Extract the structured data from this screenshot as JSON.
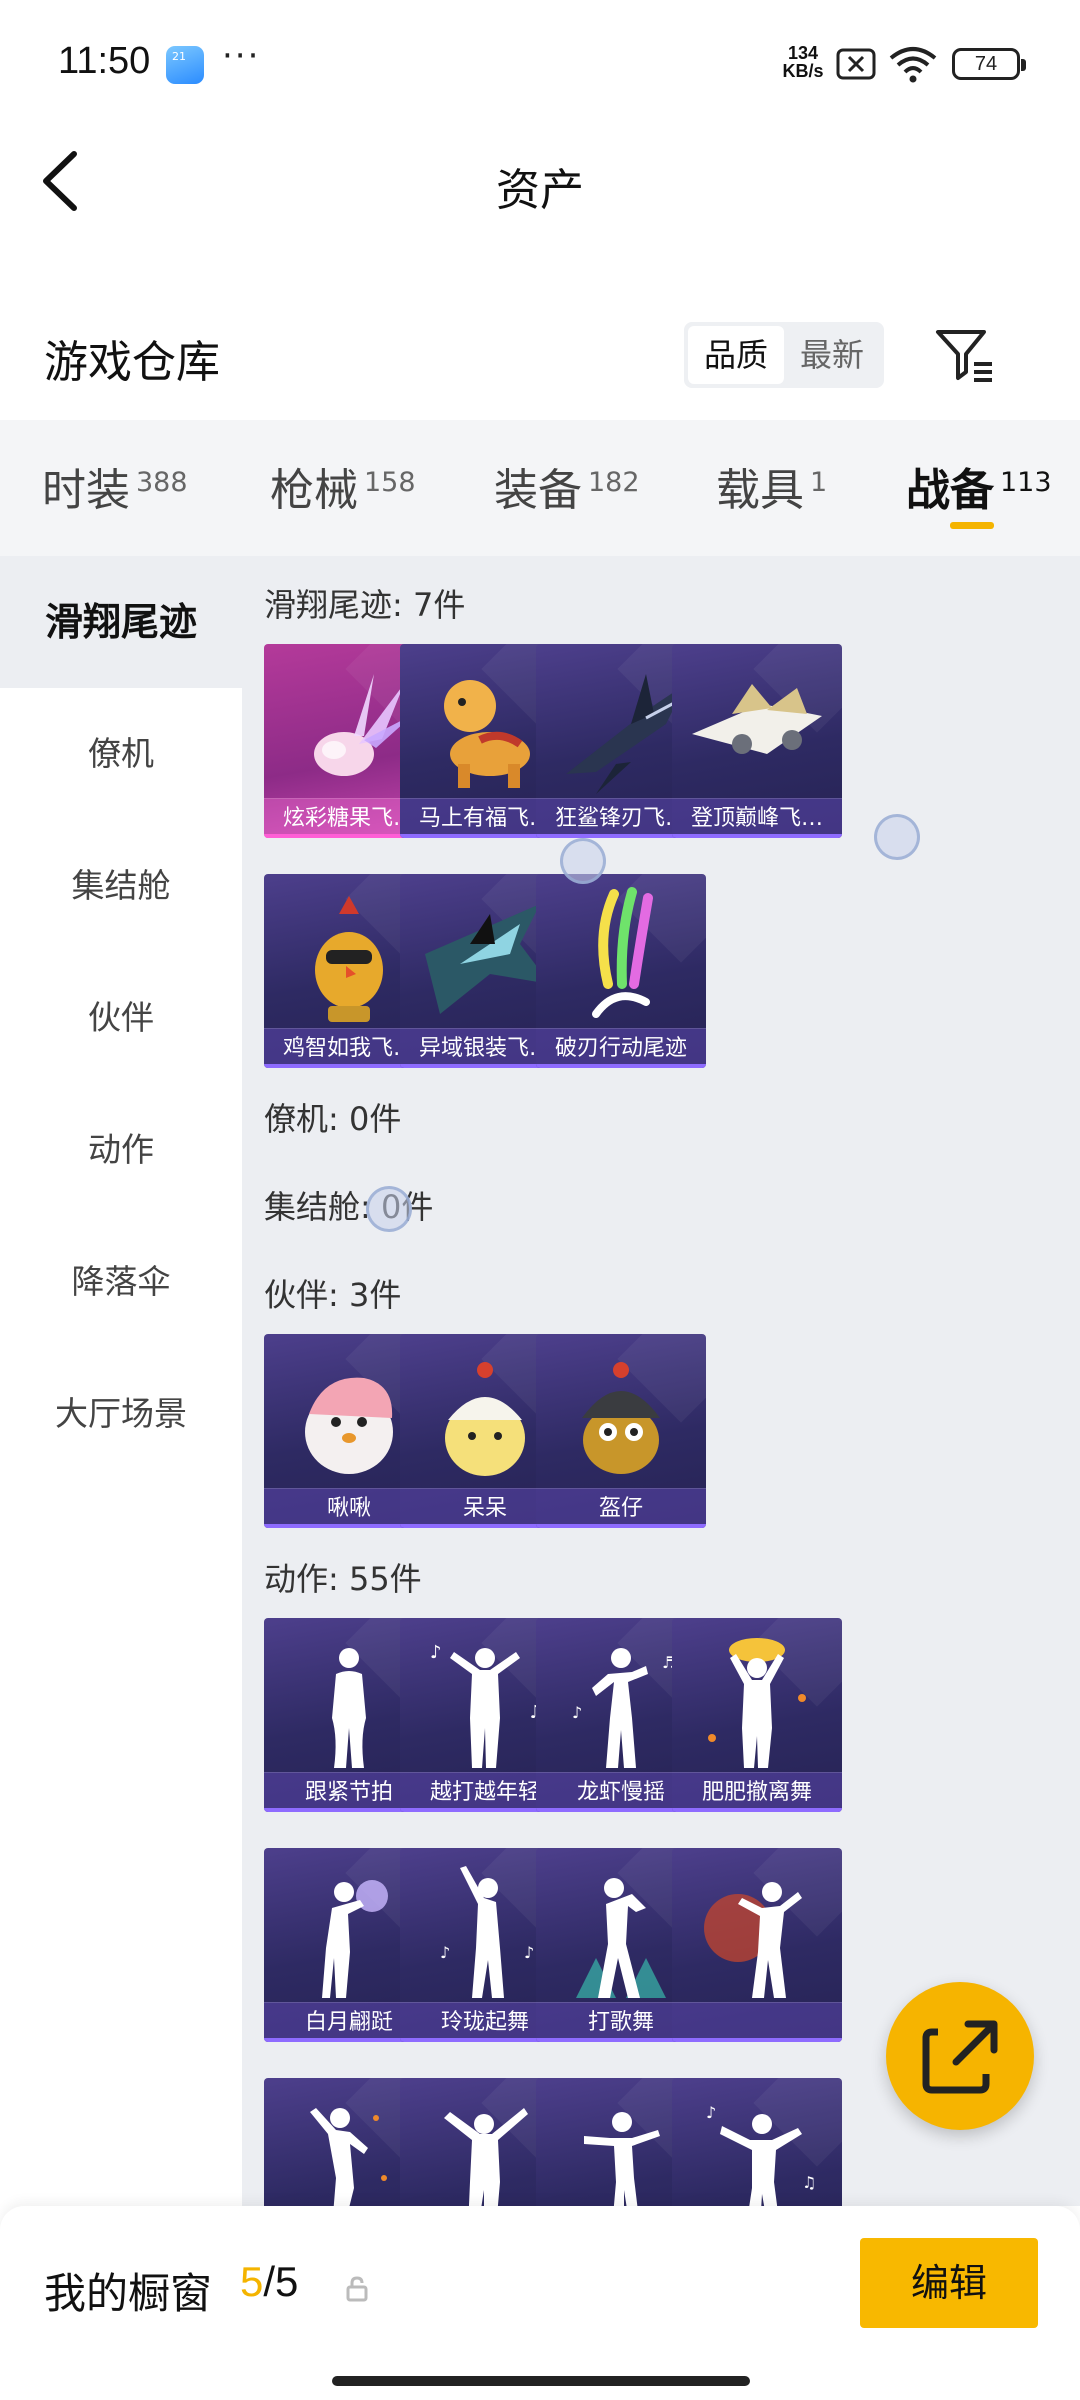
{
  "status_bar": {
    "time": "11:50",
    "app_icon_text": "21",
    "more": "···",
    "net_speed_value": "134",
    "net_speed_unit": "KB/s",
    "battery": "74"
  },
  "nav": {
    "title": "资产"
  },
  "warehouse": {
    "title": "游戏仓库",
    "sort_options": [
      "品质",
      "最新"
    ],
    "selected_sort": "品质"
  },
  "tabs": [
    {
      "label": "时装",
      "count": "388"
    },
    {
      "label": "枪械",
      "count": "158"
    },
    {
      "label": "装备",
      "count": "182"
    },
    {
      "label": "载具",
      "count": "1"
    },
    {
      "label": "战备",
      "count": "113"
    }
  ],
  "active_tab": "战备",
  "sidebar": [
    "滑翔尾迹",
    "僚机",
    "集结舱",
    "伙伴",
    "动作",
    "降落伞",
    "大厅场景"
  ],
  "active_sidebar": "滑翔尾迹",
  "sections": [
    {
      "label": "滑翔尾迹: 7件",
      "items": [
        "炫彩糖果飞…",
        "马上有福飞…",
        "狂鲨锋刃飞…",
        "登顶巅峰飞…",
        "鸡智如我飞…",
        "异域银装飞…",
        "破刃行动尾迹"
      ]
    },
    {
      "label": "僚机: 0件",
      "items": []
    },
    {
      "label": "集结舱: 0件",
      "items": []
    },
    {
      "label": "伙伴: 3件",
      "items": [
        "啾啾",
        "呆呆",
        "盔仔"
      ]
    },
    {
      "label": "动作: 55件",
      "items": [
        "跟紧节拍",
        "越打越年轻",
        "龙虾慢摇",
        "肥肥撤离舞",
        "白月翩跹",
        "玲珑起舞",
        "打歌舞",
        "",
        "",
        "",
        "",
        ""
      ]
    }
  ],
  "bottom_bar": {
    "label": "我的橱窗",
    "current": "5",
    "separator": "/",
    "total": "5",
    "edit_label": "编辑"
  },
  "colors": {
    "accent": "#f4b400",
    "card_purple": "#2e2a63",
    "card_pink": "#b43a9a"
  },
  "icons": [
    "back-icon",
    "filter-icon",
    "lock-icon",
    "share-icon",
    "wifi-icon",
    "sim-icon",
    "battery-icon"
  ]
}
